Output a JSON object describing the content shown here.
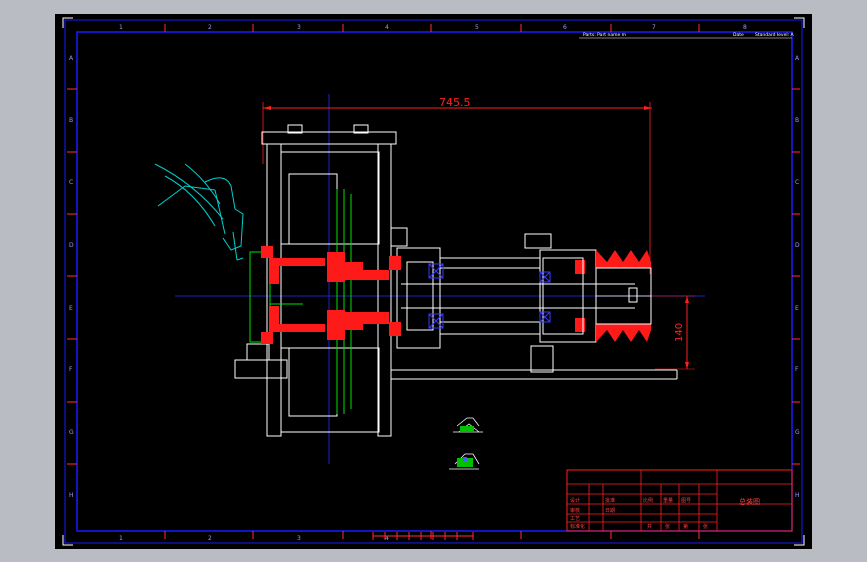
{
  "drawing": {
    "background": "#000000",
    "frame_color": "#1a1aff",
    "title_block_color": "#ff2020",
    "dimension_color": "#ff2020",
    "overall_dimension": "745.5",
    "height_dimension": "140",
    "border_numbers": [
      "1",
      "2",
      "3",
      "4",
      "5",
      "6",
      "7",
      "8"
    ],
    "border_letters": [
      "A",
      "B",
      "C",
      "D",
      "E",
      "F",
      "G",
      "H"
    ],
    "header_labels": {
      "part_name": "Parts: Part name m",
      "date": "Date",
      "standard": "Standard level: A"
    },
    "title_block": {
      "title": "总装图",
      "cells": [
        "设计",
        "审核",
        "工艺",
        "标准化",
        "批准",
        "日期",
        "比例",
        "重量",
        "图号",
        "共",
        "张",
        "第",
        "张"
      ]
    }
  }
}
